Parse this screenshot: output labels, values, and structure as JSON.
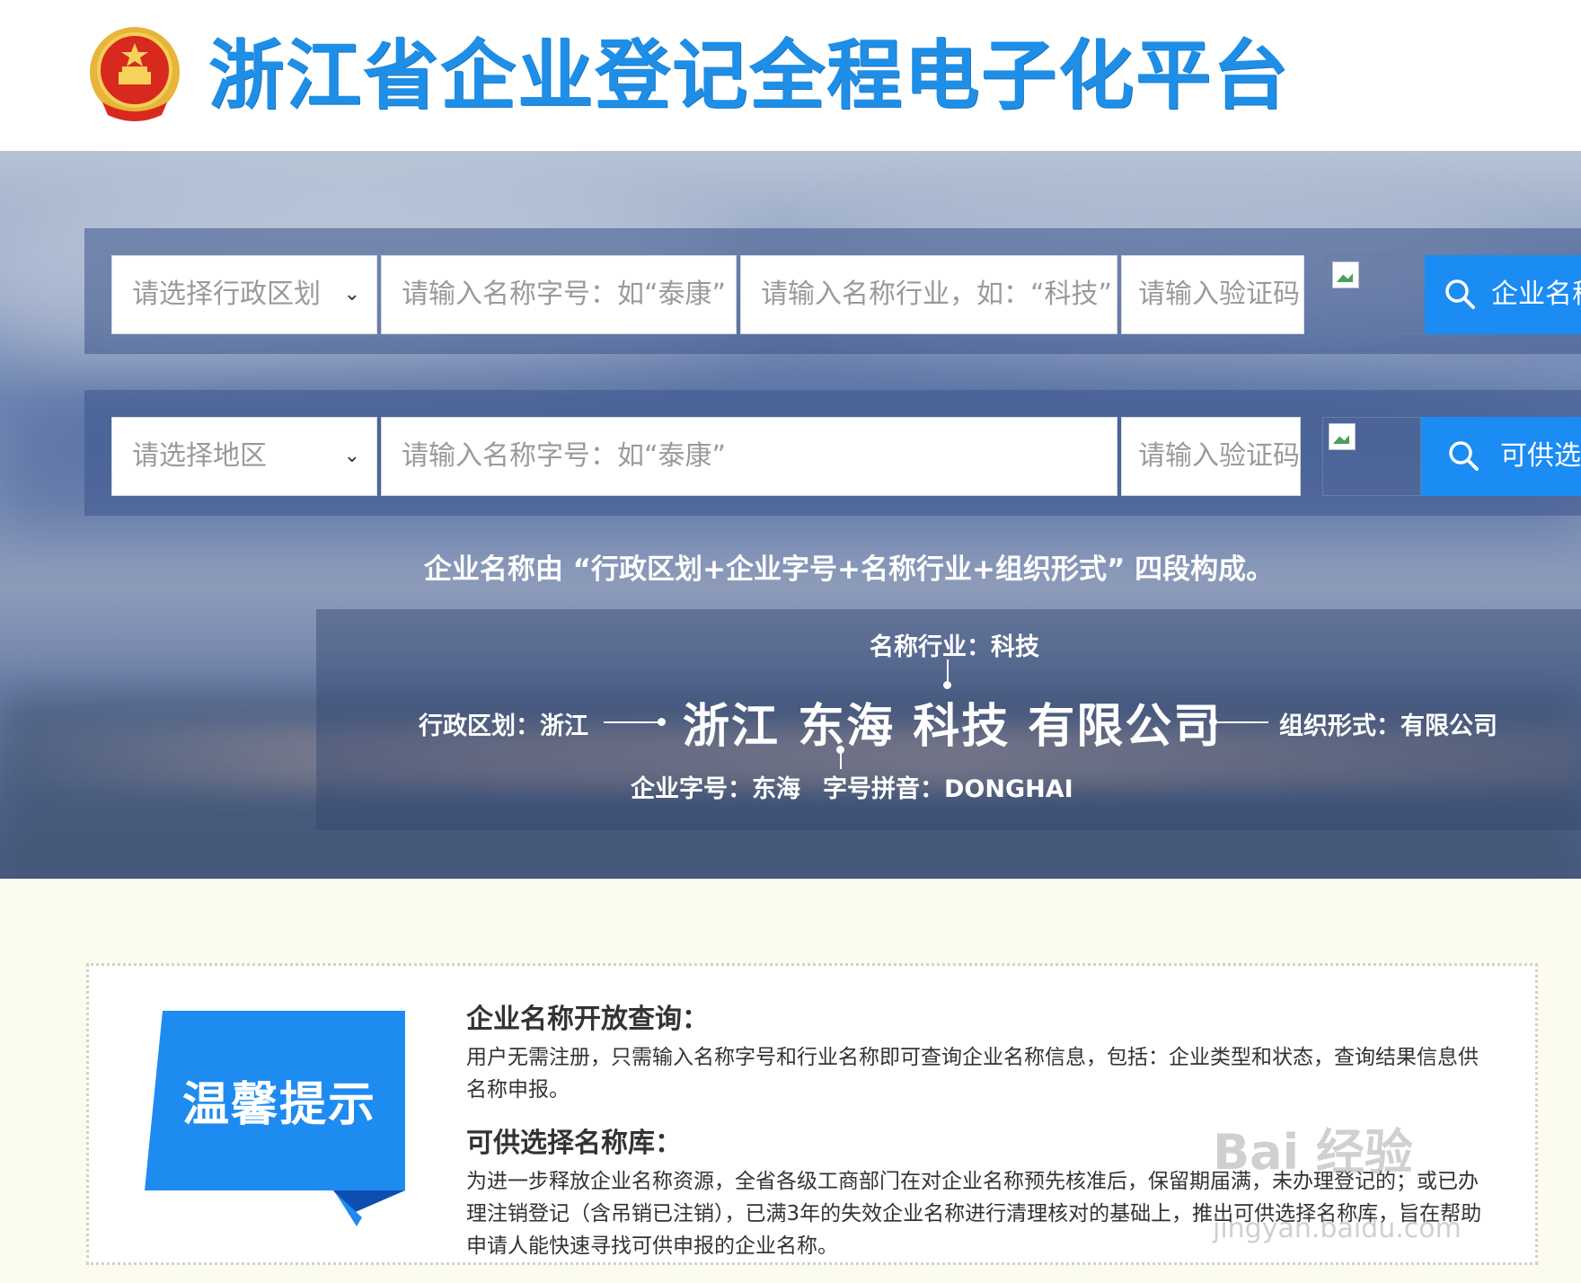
{
  "header": {
    "title": "浙江省企业登记全程电子化平台",
    "emblem_icon": "national-emblem-icon"
  },
  "search_row_1": {
    "region_select": "请选择行政区划",
    "name_input_placeholder": "请输入名称字号：如“泰康”",
    "industry_input_placeholder": "请输入名称行业，如：“科技”",
    "captcha_input_placeholder": "请输入验证码",
    "button_label": "企业名称"
  },
  "search_row_2": {
    "region_select": "请选择地区",
    "name_input_placeholder": "请输入名称字号：如“泰康”",
    "captcha_input_placeholder": "请输入验证码",
    "button_label": "可供选"
  },
  "name_rule": "企业名称由 “行政区划+企业字号+名称行业+组织形式” 四段构成。",
  "example": {
    "industry": "名称行业：科技",
    "region": "行政区划：浙江",
    "full_name": "浙江 东海 科技 有限公司",
    "org_form": "组织形式：有限公司",
    "zihao": "企业字号：东海",
    "pinyin": "字号拼音：DONGHAI"
  },
  "tips": {
    "badge": "温馨提示",
    "sections": [
      {
        "heading": "企业名称开放查询：",
        "body": "用户无需注册，只需输入名称字号和行业名称即可查询企业名称信息，包括：企业类型和状态，查询结果信息供名称申报。"
      },
      {
        "heading": "可供选择名称库：",
        "body": "为进一步释放企业名称资源，全省各级工商部门在对企业名称预先核准后，保留期届满，未办理登记的；或已办理注销登记（含吊销已注销），已满3年的失效企业名称进行清理核对的基础上，推出可供选择名称库，旨在帮助申请人能快速寻找可供申报的企业名称。"
      }
    ]
  },
  "watermark": {
    "main": "Bai 经验",
    "sub": "jingyan.baidu.com"
  },
  "colors": {
    "title_blue": "#1f8ee6",
    "button_blue": "#1a8cf4",
    "badge_blue": "#1e8bf0"
  }
}
